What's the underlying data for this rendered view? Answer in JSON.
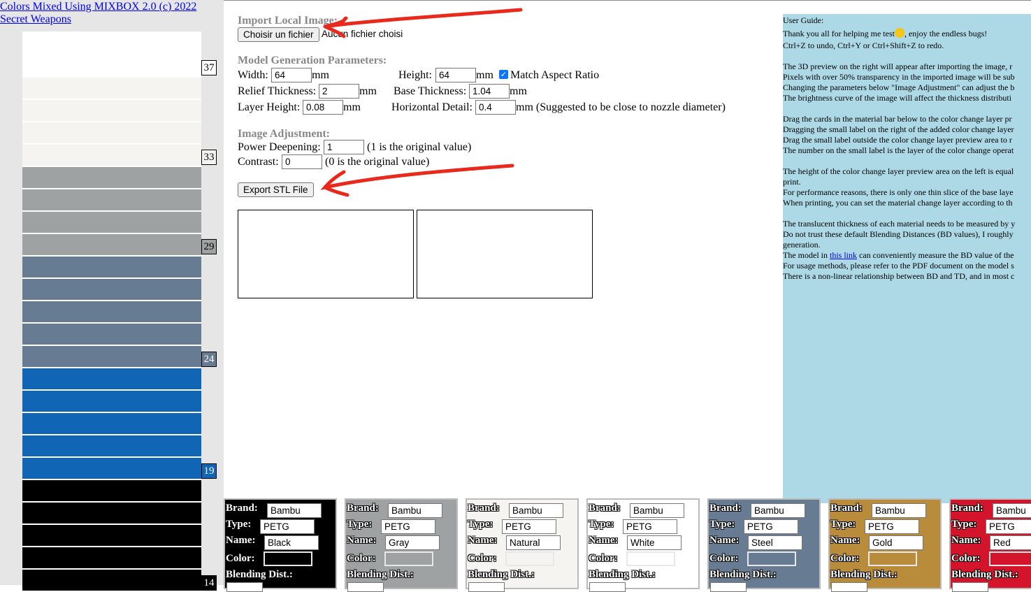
{
  "credit": {
    "line1": "Colors Mixed Using MIXBOX 2.0 (c) 2022",
    "line2": "Secret Weapons"
  },
  "layers": {
    "stripes": [
      {
        "color": "#ffffff"
      },
      {
        "color": "#ffffff"
      },
      {
        "color": "#f5f4f0"
      },
      {
        "color": "#f5f4f0"
      },
      {
        "color": "#f5f4f0"
      },
      {
        "color": "#f5f4f0"
      },
      {
        "color": "#9ea2a2"
      },
      {
        "color": "#9ea2a2"
      },
      {
        "color": "#9ea2a2"
      },
      {
        "color": "#9ea2a2"
      },
      {
        "color": "#677c93"
      },
      {
        "color": "#677c93"
      },
      {
        "color": "#677c93"
      },
      {
        "color": "#677c93"
      },
      {
        "color": "#677c93"
      },
      {
        "color": "#1065b4"
      },
      {
        "color": "#1065b4"
      },
      {
        "color": "#1065b4"
      },
      {
        "color": "#1065b4"
      },
      {
        "color": "#1065b4"
      },
      {
        "color": "#000000"
      },
      {
        "color": "#000000"
      },
      {
        "color": "#000000"
      },
      {
        "color": "#000000"
      },
      {
        "color": "#000000"
      }
    ],
    "labels": [
      {
        "text": "37",
        "bg": "#ffffff",
        "fg": "#000000"
      },
      {
        "text": "33",
        "bg": "#f5f4f0",
        "fg": "#000000"
      },
      {
        "text": "29",
        "bg": "#9ea2a2",
        "fg": "#000000"
      },
      {
        "text": "24",
        "bg": "#677c93",
        "fg": "#ffffff"
      },
      {
        "text": "19",
        "bg": "#1065b4",
        "fg": "#ffffff"
      },
      {
        "text": "14",
        "bg": "#000000",
        "fg": "#ffffff"
      }
    ]
  },
  "import": {
    "title": "Import Local Image:",
    "button": "Choisir un fichier",
    "status": "Aucun fichier choisi"
  },
  "model": {
    "title": "Model Generation Parameters:",
    "width_label": "Width:",
    "width_value": "64",
    "height_label": "Height:",
    "height_value": "64",
    "unit": "mm",
    "match_aspect": "Match Aspect Ratio",
    "relief_label": "Relief Thickness:",
    "relief_value": "2",
    "base_label": "Base Thickness:",
    "base_value": "1.04",
    "layer_label": "Layer Height:",
    "layer_value": "0.08",
    "hdetail_label": "Horizontal Detail:",
    "hdetail_value": "0.4",
    "hdetail_note": "mm (Suggested to be close to nozzle diameter)"
  },
  "adjust": {
    "title": "Image Adjustment:",
    "power_label": "Power Deepening:",
    "power_value": "1",
    "power_note": "(1 is the original value)",
    "contrast_label": "Contrast:",
    "contrast_value": "0",
    "contrast_note": "(0 is the original value)"
  },
  "export": {
    "button": "Export STL File"
  },
  "guide": {
    "lines": [
      "User Guide:",
      "Thank you all for helping me test",
      ", enjoy the endless bugs!",
      "Ctrl+Z to undo, Ctrl+Y or Ctrl+Shift+Z to redo.",
      "The 3D preview on the right will appear after importing the image, r",
      "Pixels with over 50% transparency in the imported image will be sub",
      "Changing the parameters below \"Image Adjustment\" can adjust the b",
      "The brightness curve of the image will affect the thickness distributi",
      "Drag the cards in the material bar below to the color change layer pr",
      "Dragging the small label on the right of the added color change layer",
      "Drag the small label outside the color change layer preview area to r",
      "The number on the small label is the layer of the color change operat",
      "The height of the color change layer preview area on the left is equal",
      "print.",
      "For performance reasons, there is only one thin slice of the base laye",
      "When printing, you can set the material change layer according to th",
      "The translucent thickness of each material needs to be measured by y",
      "Do not trust these default Blending Distances (BD values), I roughly",
      "generation.",
      "The model in ",
      "this link",
      " can conveniently measure the BD value of the",
      "For usage methods, please refer to the PDF document on the model s",
      "There is a non-linear relationship between BD and TD, and in most c"
    ]
  },
  "cards_labels": {
    "brand": "Brand:",
    "type": "Type:",
    "name": "Name:",
    "color": "Color:",
    "bd": "Blending Dist.:"
  },
  "cards": [
    {
      "brand": "Bambu",
      "type": "PETG",
      "name": "Black",
      "color": "#000000"
    },
    {
      "brand": "Bambu",
      "type": "PETG",
      "name": "Gray",
      "color": "#9ea2a2"
    },
    {
      "brand": "Bambu",
      "type": "PETG",
      "name": "Natural",
      "color": "#f5f4f0"
    },
    {
      "brand": "Bambu",
      "type": "PETG",
      "name": "White",
      "color": "#ffffff"
    },
    {
      "brand": "Bambu",
      "type": "PETG",
      "name": "Steel",
      "color": "#677c93"
    },
    {
      "brand": "Bambu",
      "type": "PETG",
      "name": "Gold",
      "color": "#b98c3c"
    },
    {
      "brand": "Bambu",
      "type": "PETG",
      "name": "Red",
      "color": "#d3142b"
    }
  ]
}
